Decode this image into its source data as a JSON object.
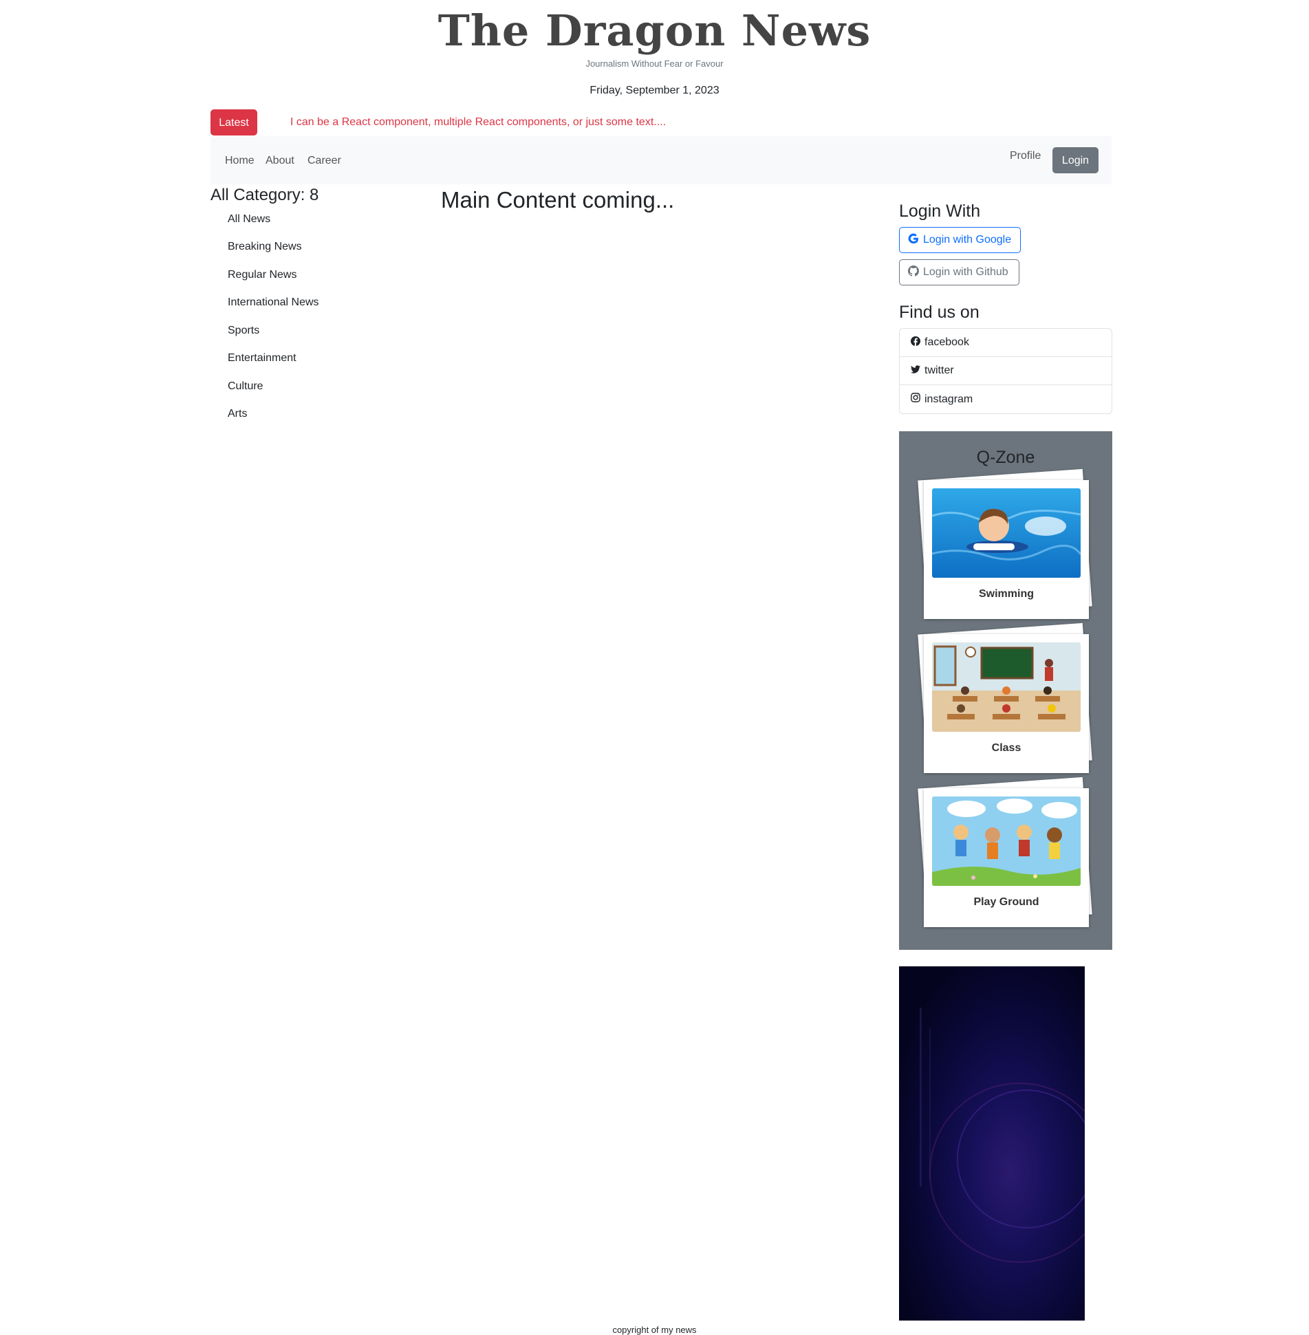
{
  "header": {
    "brand": "The Dragon News",
    "tagline": "Journalism Without Fear or Favour",
    "date": "Friday, September 1, 2023"
  },
  "ticker": {
    "latest_label": "Latest",
    "text": "I can be a React component, multiple React components, or just some text...."
  },
  "nav": {
    "links": [
      "Home",
      "About",
      "Career"
    ],
    "profile": "Profile",
    "login": "Login"
  },
  "categories": {
    "title": "All Category: 8",
    "items": [
      "All News",
      "Breaking News",
      "Regular News",
      "International News",
      "Sports",
      "Entertainment",
      "Culture",
      "Arts"
    ]
  },
  "main": {
    "title": "Main Content coming..."
  },
  "right": {
    "login_title": "Login With",
    "google_label": "Login with Google",
    "github_label": "Login with Github",
    "find_title": "Find us on",
    "find_items": [
      {
        "label": "facebook",
        "icon": "facebook-icon"
      },
      {
        "label": "twitter",
        "icon": "twitter-icon"
      },
      {
        "label": "instagram",
        "icon": "instagram-icon"
      }
    ],
    "qzone_title": "Q-Zone",
    "qzone_cards": [
      "Swimming",
      "Class",
      "Play Ground"
    ]
  },
  "colors": {
    "danger": "#dc3545",
    "primary": "#0d6efd",
    "secondary": "#6c757d",
    "navbar_bg": "#f8f9fa"
  },
  "footer": {
    "text": "copyright of my news"
  }
}
